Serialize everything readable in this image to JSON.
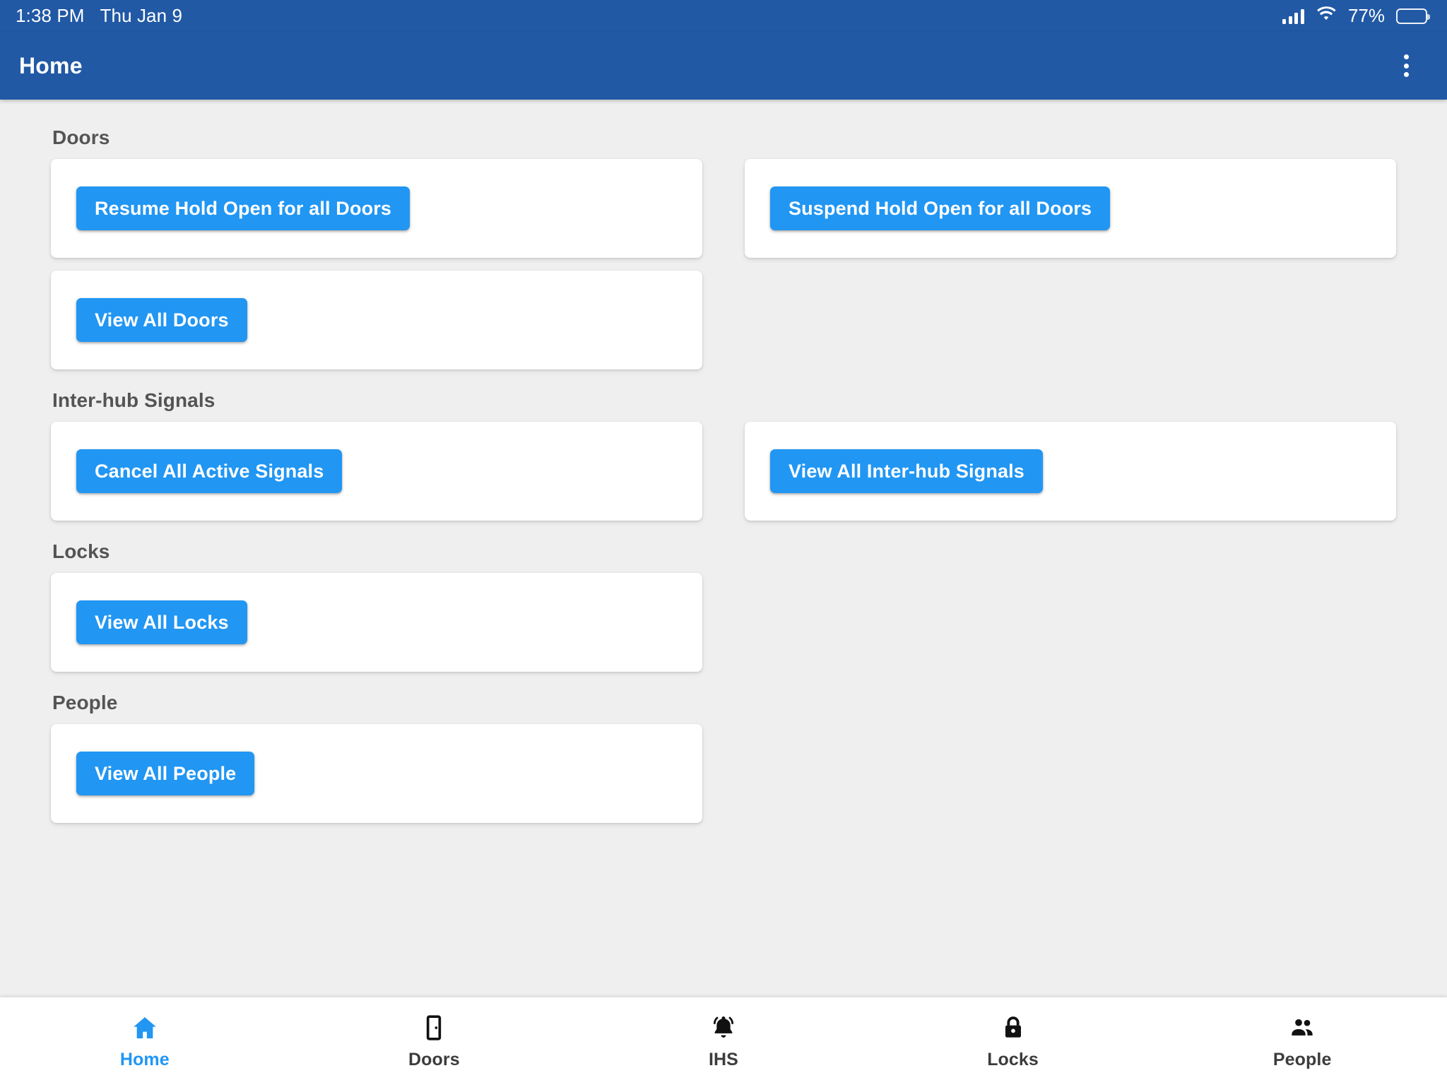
{
  "status_bar": {
    "time": "1:38 PM",
    "date": "Thu Jan 9",
    "battery_percent": "77%",
    "signal_icon": "cellular-signal-icon",
    "wifi_icon": "wifi-icon",
    "battery_icon": "battery-icon"
  },
  "app_bar": {
    "title": "Home",
    "overflow_icon": "more-vertical-icon"
  },
  "theme": {
    "appbar_blue": "#2159a5",
    "button_blue": "#2196f3",
    "page_background": "#efefef",
    "card_background": "#ffffff",
    "section_title_color": "#545454"
  },
  "sections": [
    {
      "title": "Doors",
      "cards": [
        {
          "button": "Resume Hold Open for all Doors",
          "empty": false
        },
        {
          "button": "Suspend Hold Open for all Doors",
          "empty": false
        },
        {
          "button": "View All Doors",
          "empty": false
        },
        {
          "button": "",
          "empty": true
        }
      ]
    },
    {
      "title": "Inter-hub Signals",
      "cards": [
        {
          "button": "Cancel All Active Signals",
          "empty": false
        },
        {
          "button": "View All Inter-hub Signals",
          "empty": false
        }
      ]
    },
    {
      "title": "Locks",
      "cards": [
        {
          "button": "View All Locks",
          "empty": false
        },
        {
          "button": "",
          "empty": true
        }
      ]
    },
    {
      "title": "People",
      "cards": [
        {
          "button": "View All People",
          "empty": false
        },
        {
          "button": "",
          "empty": true
        }
      ]
    }
  ],
  "bottom_nav": {
    "items": [
      {
        "label": "Home",
        "icon": "home-icon",
        "active": true
      },
      {
        "label": "Doors",
        "icon": "door-icon",
        "active": false
      },
      {
        "label": "IHS",
        "icon": "bell-ringing-icon",
        "active": false
      },
      {
        "label": "Locks",
        "icon": "lock-icon",
        "active": false
      },
      {
        "label": "People",
        "icon": "people-icon",
        "active": false
      }
    ]
  }
}
